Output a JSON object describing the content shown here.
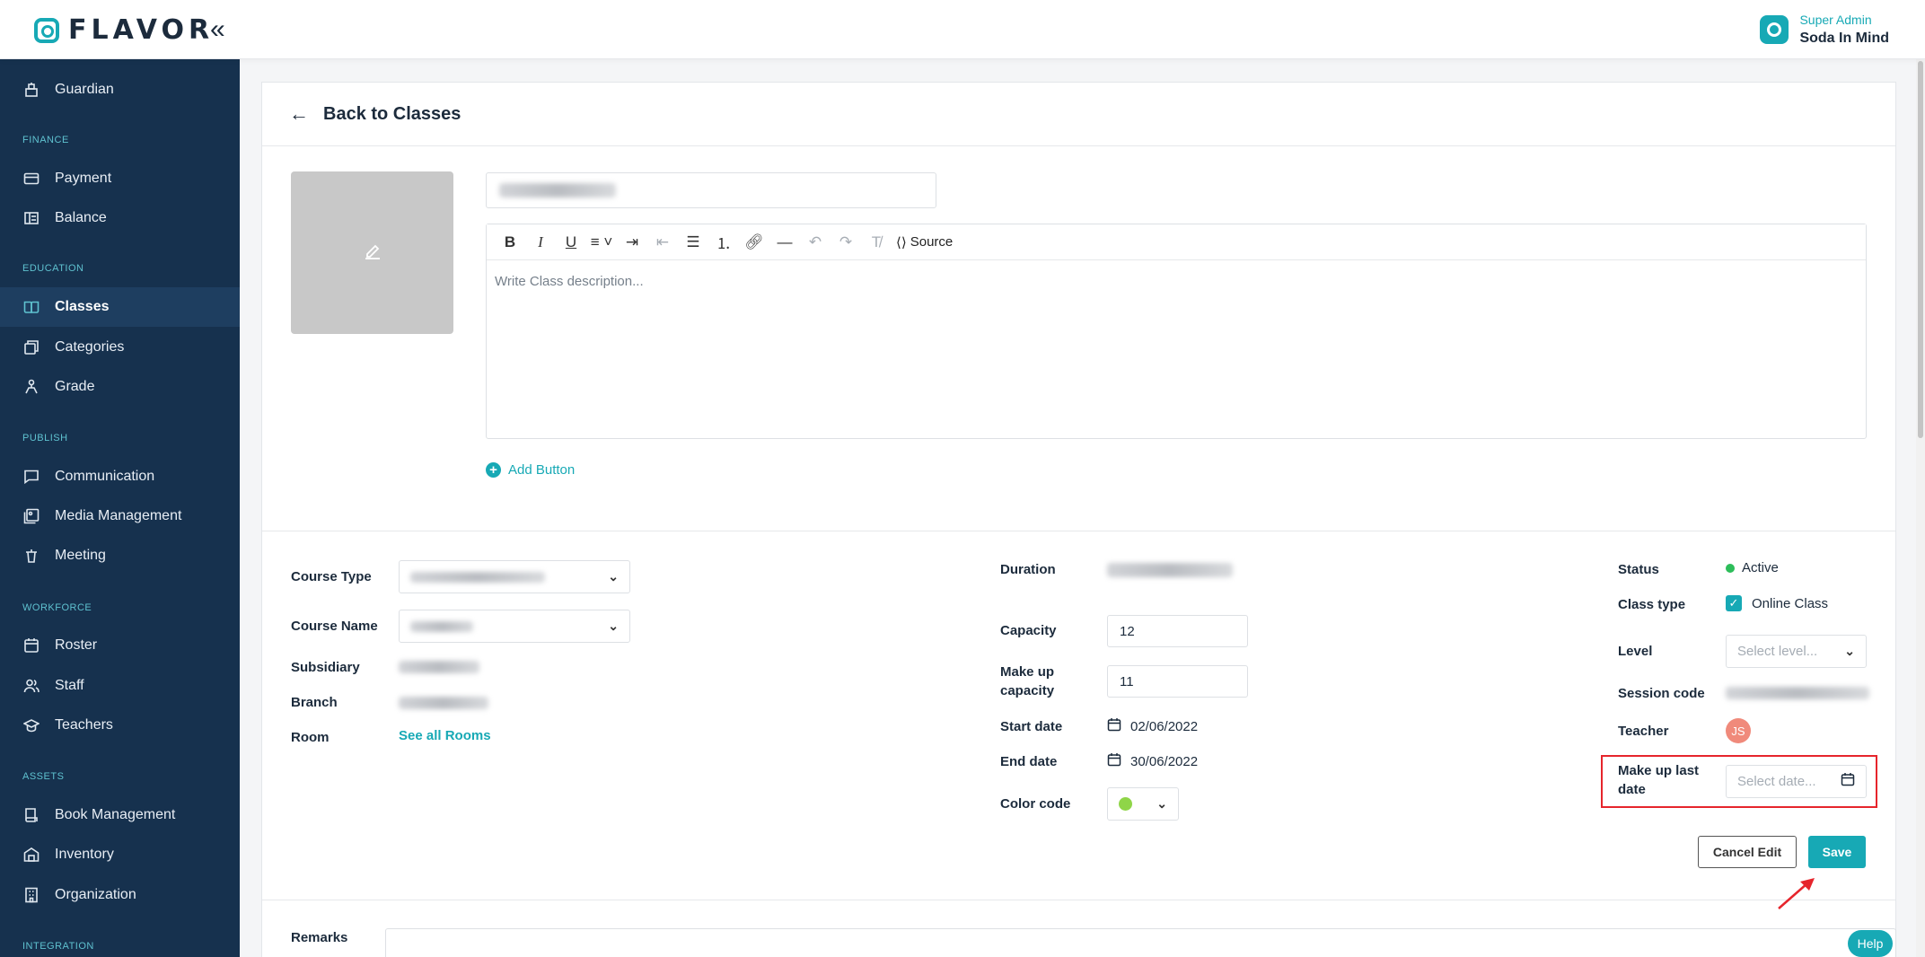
{
  "header": {
    "logo_text": "FLAVOR",
    "collapse_icon": "«",
    "user_role": "Super Admin",
    "user_name": "Soda In Mind"
  },
  "sidebar": {
    "sections": {
      "finance": "FINANCE",
      "education": "EDUCATION",
      "publish": "PUBLISH",
      "workforce": "WORKFORCE",
      "assets": "ASSETS",
      "integration": "INTEGRATION"
    },
    "items": {
      "guardian": "Guardian",
      "payment": "Payment",
      "balance": "Balance",
      "classes": "Classes",
      "categories": "Categories",
      "grade": "Grade",
      "communication": "Communication",
      "media": "Media Management",
      "meeting": "Meeting",
      "roster": "Roster",
      "staff": "Staff",
      "teachers": "Teachers",
      "book": "Book Management",
      "inventory": "Inventory",
      "organization": "Organization"
    },
    "active": "Classes"
  },
  "page": {
    "back_label": "Back to Classes",
    "editor_placeholder": "Write Class description...",
    "source_label": "Source",
    "add_button_label": "Add Button"
  },
  "details": {
    "course_type_label": "Course Type",
    "course_name_label": "Course Name",
    "subsidiary_label": "Subsidiary",
    "branch_label": "Branch",
    "room_label": "Room",
    "room_link": "See all Rooms",
    "duration_label": "Duration",
    "capacity_label": "Capacity",
    "capacity_value": "12",
    "makeup_capacity_label": "Make up capacity",
    "makeup_capacity_value": "11",
    "start_date_label": "Start date",
    "start_date_value": "02/06/2022",
    "end_date_label": "End date",
    "end_date_value": "30/06/2022",
    "color_code_label": "Color code",
    "color_code_value": "#8fd548",
    "status_label": "Status",
    "status_value": "Active",
    "class_type_label": "Class type",
    "class_type_value": "Online Class",
    "level_label": "Level",
    "level_placeholder": "Select level...",
    "session_code_label": "Session code",
    "teacher_label": "Teacher",
    "teacher_initials": "JS",
    "makeup_last_date_label": "Make up last date",
    "makeup_last_date_placeholder": "Select date...",
    "remarks_label": "Remarks"
  },
  "actions": {
    "cancel_label": "Cancel Edit",
    "save_label": "Save",
    "help_label": "Help"
  },
  "colors": {
    "accent": "#17a9b5",
    "sidebar_bg": "#16314e",
    "highlight": "#e6252c"
  }
}
